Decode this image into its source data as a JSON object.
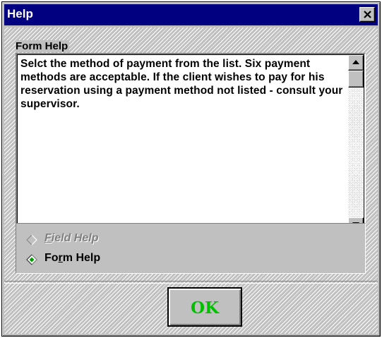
{
  "window": {
    "title": "Help"
  },
  "form_help": {
    "label": "Form Help",
    "text": "Selct the method of payment from the list. Six payment methods are acceptable. If the client wishes to pay for his reservation using a payment method not listed - consult your supervisor."
  },
  "help_mode": {
    "options": [
      {
        "prefix": "",
        "mnemonic": "F",
        "suffix": "ield Help",
        "enabled": false,
        "selected": false
      },
      {
        "prefix": "Fo",
        "mnemonic": "r",
        "suffix": "m Help",
        "enabled": true,
        "selected": true
      }
    ]
  },
  "buttons": {
    "ok_label": "OK"
  },
  "colors": {
    "title_bar": "#000080",
    "dialog_face": "#c0c0c0",
    "selected_radio": "#00a000",
    "ok_text": "#00c000"
  },
  "icons": {
    "close": "close-icon",
    "scroll_up": "arrow-up-icon",
    "scroll_down": "arrow-down-icon"
  }
}
